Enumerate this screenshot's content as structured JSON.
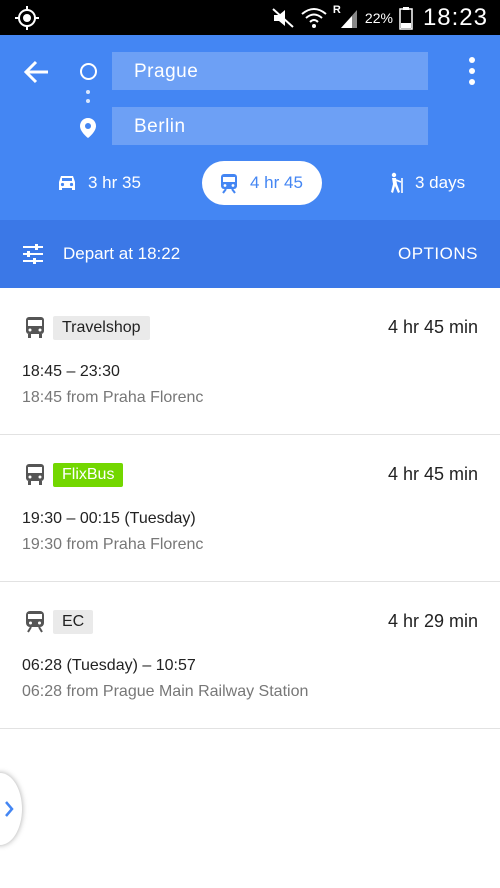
{
  "status_bar": {
    "battery_percent": "22%",
    "time": "18:23",
    "network_letter": "R"
  },
  "header": {
    "origin": "Prague",
    "destination": "Berlin",
    "modes": [
      {
        "name": "drive",
        "duration": "3 hr 35"
      },
      {
        "name": "transit",
        "duration": "4 hr 45",
        "selected": true
      },
      {
        "name": "walk",
        "duration": "3 days"
      }
    ]
  },
  "depart_bar": {
    "label": "Depart at 18:22",
    "options": "OPTIONS"
  },
  "routes": [
    {
      "icon": "bus-icon",
      "carrier": "Travelshop",
      "duration": "4 hr 45 min",
      "times": "18:45 – 23:30",
      "from": "18:45 from Praha Florenc"
    },
    {
      "icon": "bus-icon",
      "carrier": "FlixBus",
      "duration": "4 hr 45 min",
      "times": "19:30 – 00:15 (Tuesday)",
      "from": "19:30 from Praha Florenc"
    },
    {
      "icon": "train-icon",
      "carrier": "EC",
      "duration": "4 hr 29 min",
      "times": "06:28 (Tuesday) – 10:57",
      "from": "06:28 from Prague Main Railway Station"
    }
  ],
  "colors": {
    "header_blue": "#4486f3",
    "depart_blue": "#3b78e7",
    "flixbus_green": "#73d700"
  }
}
